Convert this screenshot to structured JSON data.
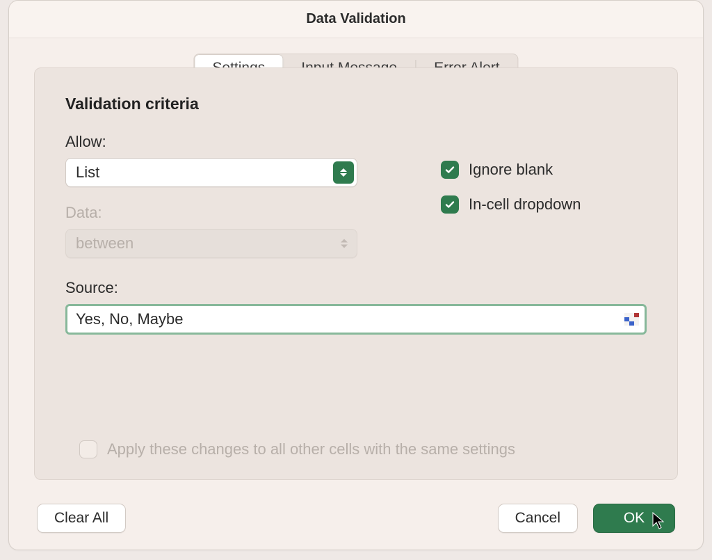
{
  "title": "Data Validation",
  "tabs": {
    "settings": "Settings",
    "input_message": "Input Message",
    "error_alert": "Error Alert"
  },
  "section_title": "Validation criteria",
  "allow": {
    "label": "Allow:",
    "value": "List"
  },
  "data": {
    "label": "Data:",
    "value": "between"
  },
  "source": {
    "label": "Source:",
    "value": "Yes, No, Maybe"
  },
  "checkboxes": {
    "ignore_blank": "Ignore blank",
    "in_cell_dropdown": "In-cell dropdown",
    "apply_all": "Apply these changes to all other cells with the same settings"
  },
  "buttons": {
    "clear_all": "Clear All",
    "cancel": "Cancel",
    "ok": "OK"
  }
}
